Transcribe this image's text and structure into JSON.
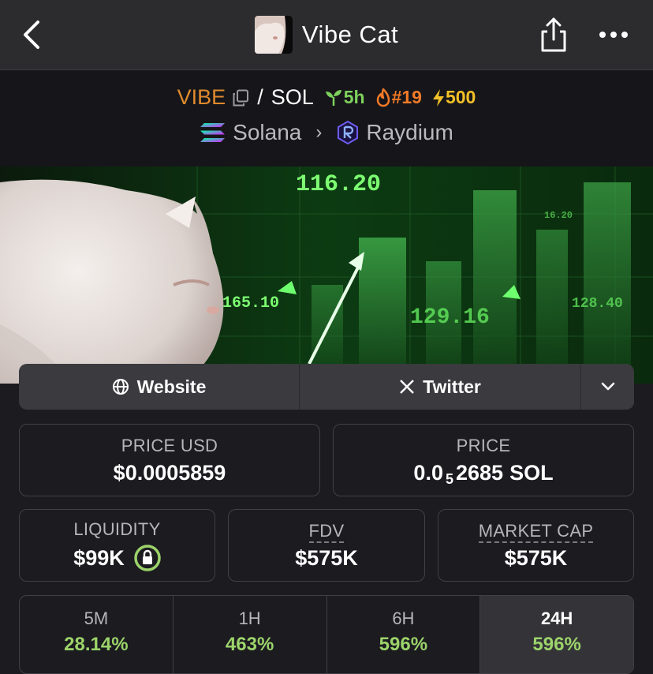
{
  "topbar": {
    "title": "Vibe Cat",
    "back_icon": "chevron-left-icon",
    "share_icon": "share-icon",
    "more_icon": "more-horizontal-icon"
  },
  "pair": {
    "base": "VIBE",
    "separator": "/",
    "quote": "SOL",
    "age": "5h",
    "rank": "#19",
    "boost": "500"
  },
  "chain": {
    "network": "Solana",
    "dex": "Raydium"
  },
  "banner": {
    "label_top": "116.20",
    "label_left": "165.10",
    "label_mid": "129.16",
    "label_right": "128.40",
    "label_small": "16.20"
  },
  "links": {
    "website": "Website",
    "twitter": "Twitter"
  },
  "stats": {
    "price_usd_label": "PRICE USD",
    "price_usd_value": "$0.0005859",
    "price_label": "PRICE",
    "price_prefix": "0.0",
    "price_zeros": "5",
    "price_digits": "2685",
    "price_unit": "SOL",
    "liquidity_label": "LIQUIDITY",
    "liquidity_value": "$99K",
    "fdv_label": "FDV",
    "fdv_value": "$575K",
    "mcap_label": "MARKET CAP",
    "mcap_value": "$575K"
  },
  "changes": [
    {
      "label": "5M",
      "value": "28.14%"
    },
    {
      "label": "1H",
      "value": "463%"
    },
    {
      "label": "6H",
      "value": "596%"
    },
    {
      "label": "24H",
      "value": "596%"
    }
  ],
  "colors": {
    "accent_orange": "#e08a2c",
    "positive_green": "#9cd36a",
    "age_green": "#7fd15c",
    "boost_yellow": "#f2c027"
  }
}
